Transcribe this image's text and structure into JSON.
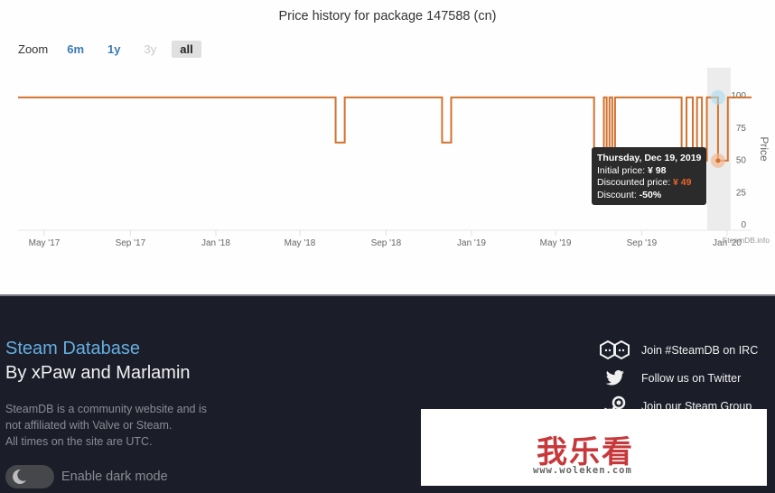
{
  "chart_data": {
    "type": "line",
    "step": true,
    "title": "Price history for package 147588 (cn)",
    "xlabel": "",
    "ylabel": "Price",
    "ylim": [
      0,
      100
    ],
    "yticks": [
      0,
      25,
      50,
      75,
      100
    ],
    "xticks": [
      {
        "label": "May '17",
        "date": "2017-05-01"
      },
      {
        "label": "Sep '17",
        "date": "2017-09-01"
      },
      {
        "label": "Jan '18",
        "date": "2018-01-01"
      },
      {
        "label": "May '18",
        "date": "2018-05-01"
      },
      {
        "label": "Sep '18",
        "date": "2018-09-01"
      },
      {
        "label": "Jan '19",
        "date": "2019-01-01"
      },
      {
        "label": "May '19",
        "date": "2019-05-01"
      },
      {
        "label": "Sep '19",
        "date": "2019-09-01"
      },
      {
        "label": "Jan '20",
        "date": "2020-01-01"
      }
    ],
    "xrange": [
      "2017-04-01",
      "2020-02-01"
    ],
    "grid": false,
    "series": [
      {
        "name": "Price",
        "color": "#d2732f",
        "points": [
          {
            "date": "2017-04-01",
            "value": 98
          },
          {
            "date": "2018-06-21",
            "value": 63
          },
          {
            "date": "2018-07-04",
            "value": 98
          },
          {
            "date": "2018-11-20",
            "value": 63
          },
          {
            "date": "2018-12-03",
            "value": 98
          },
          {
            "date": "2019-06-25",
            "value": 49
          },
          {
            "date": "2019-07-09",
            "value": 98
          },
          {
            "date": "2019-07-13",
            "value": 49
          },
          {
            "date": "2019-07-17",
            "value": 98
          },
          {
            "date": "2019-07-21",
            "value": 49
          },
          {
            "date": "2019-07-25",
            "value": 98
          },
          {
            "date": "2019-10-28",
            "value": 49
          },
          {
            "date": "2019-11-04",
            "value": 98
          },
          {
            "date": "2019-11-13",
            "value": 49
          },
          {
            "date": "2019-11-19",
            "value": 98
          },
          {
            "date": "2019-11-26",
            "value": 49
          },
          {
            "date": "2019-12-03",
            "value": 98
          },
          {
            "date": "2019-12-19",
            "value": 49
          },
          {
            "date": "2020-01-02",
            "value": 98
          },
          {
            "date": "2020-02-01",
            "value": 98
          }
        ]
      }
    ],
    "highlight": {
      "date": "2019-12-19",
      "initial_price": 98,
      "discounted_price": 49
    },
    "credits": "SteamDB.info"
  },
  "zoom": {
    "label": "Zoom",
    "buttons": [
      {
        "label": "6m",
        "state": "enabled"
      },
      {
        "label": "1y",
        "state": "enabled"
      },
      {
        "label": "3y",
        "state": "disabled"
      },
      {
        "label": "all",
        "state": "selected"
      }
    ]
  },
  "tooltip": {
    "date": "Thursday, Dec 19, 2019",
    "initial_label": "Initial price: ",
    "initial_value": "¥ 98",
    "discounted_label": "Discounted price: ",
    "discounted_value": "¥ 49",
    "discount_label": "Discount: ",
    "discount_value": "-50%"
  },
  "footer": {
    "brand": "Steam Database",
    "byline": "By xPaw and Marlamin",
    "disclaimer": [
      "SteamDB is a community website and is",
      "not affiliated with Valve or Steam.",
      "All times on the site are UTC."
    ],
    "dark_mode_label": "Enable dark mode",
    "social": [
      {
        "icon": "irc-icon",
        "label": "Join #SteamDB on IRC"
      },
      {
        "icon": "twitter-icon",
        "label": "Follow us on Twitter"
      },
      {
        "icon": "steam-icon",
        "label": "Join our Steam Group"
      }
    ]
  },
  "watermark": {
    "text": "我乐看",
    "url": "www.woleken.com"
  },
  "colors": {
    "line": "#d2732f",
    "accent": "#66aee0",
    "footer_bg": "#1b1d29",
    "discount": "#e8652a"
  }
}
